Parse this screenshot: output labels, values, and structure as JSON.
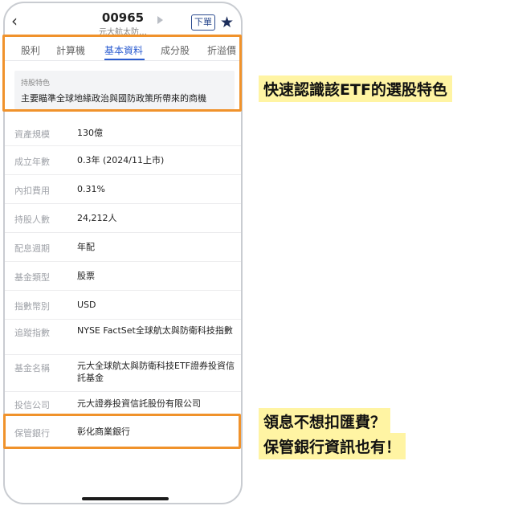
{
  "header": {
    "back_icon": "chevron-left-icon",
    "code": "00965",
    "name": "元大航太防…",
    "order_label": "下單",
    "star_icon": "star-icon"
  },
  "tabs": [
    {
      "label": "股利",
      "active": false
    },
    {
      "label": "計算機",
      "active": false
    },
    {
      "label": "基本資料",
      "active": true
    },
    {
      "label": "成分股",
      "active": false
    },
    {
      "label": "折溢價",
      "active": false
    }
  ],
  "feature": {
    "label": "持股特色",
    "text": "主要瞄準全球地緣政治與國防政策所帶來的商機"
  },
  "rows": [
    {
      "label": "資產規模",
      "value": "130億"
    },
    {
      "label": "成立年數",
      "value": "0.3年 (2024/11上市)"
    },
    {
      "label": "內扣費用",
      "value": "0.31%"
    },
    {
      "label": "持股人數",
      "value": "24,212人"
    },
    {
      "label": "配息週期",
      "value": "年配"
    },
    {
      "label": "基金類型",
      "value": "股票"
    },
    {
      "label": "指數幣別",
      "value": "USD"
    },
    {
      "label": "追蹤指數",
      "value": "NYSE FactSet全球航太與防衛科技指數"
    },
    {
      "label": "基金名稱",
      "value": "元大全球航太與防衛科技ETF證券投資信託基金"
    },
    {
      "label": "投信公司",
      "value": "元大證券投資信託股份有限公司"
    },
    {
      "label": "保管銀行",
      "value": "彰化商業銀行"
    }
  ],
  "callouts": {
    "top": "快速認識該ETF的選股特色",
    "bottom_line1": "領息不想扣匯費？",
    "bottom_line2": "保管銀行資訊也有！"
  },
  "colors": {
    "accent": "#2b5cd0",
    "highlight_border": "#f0922b",
    "callout_bg": "#fff4a3"
  }
}
